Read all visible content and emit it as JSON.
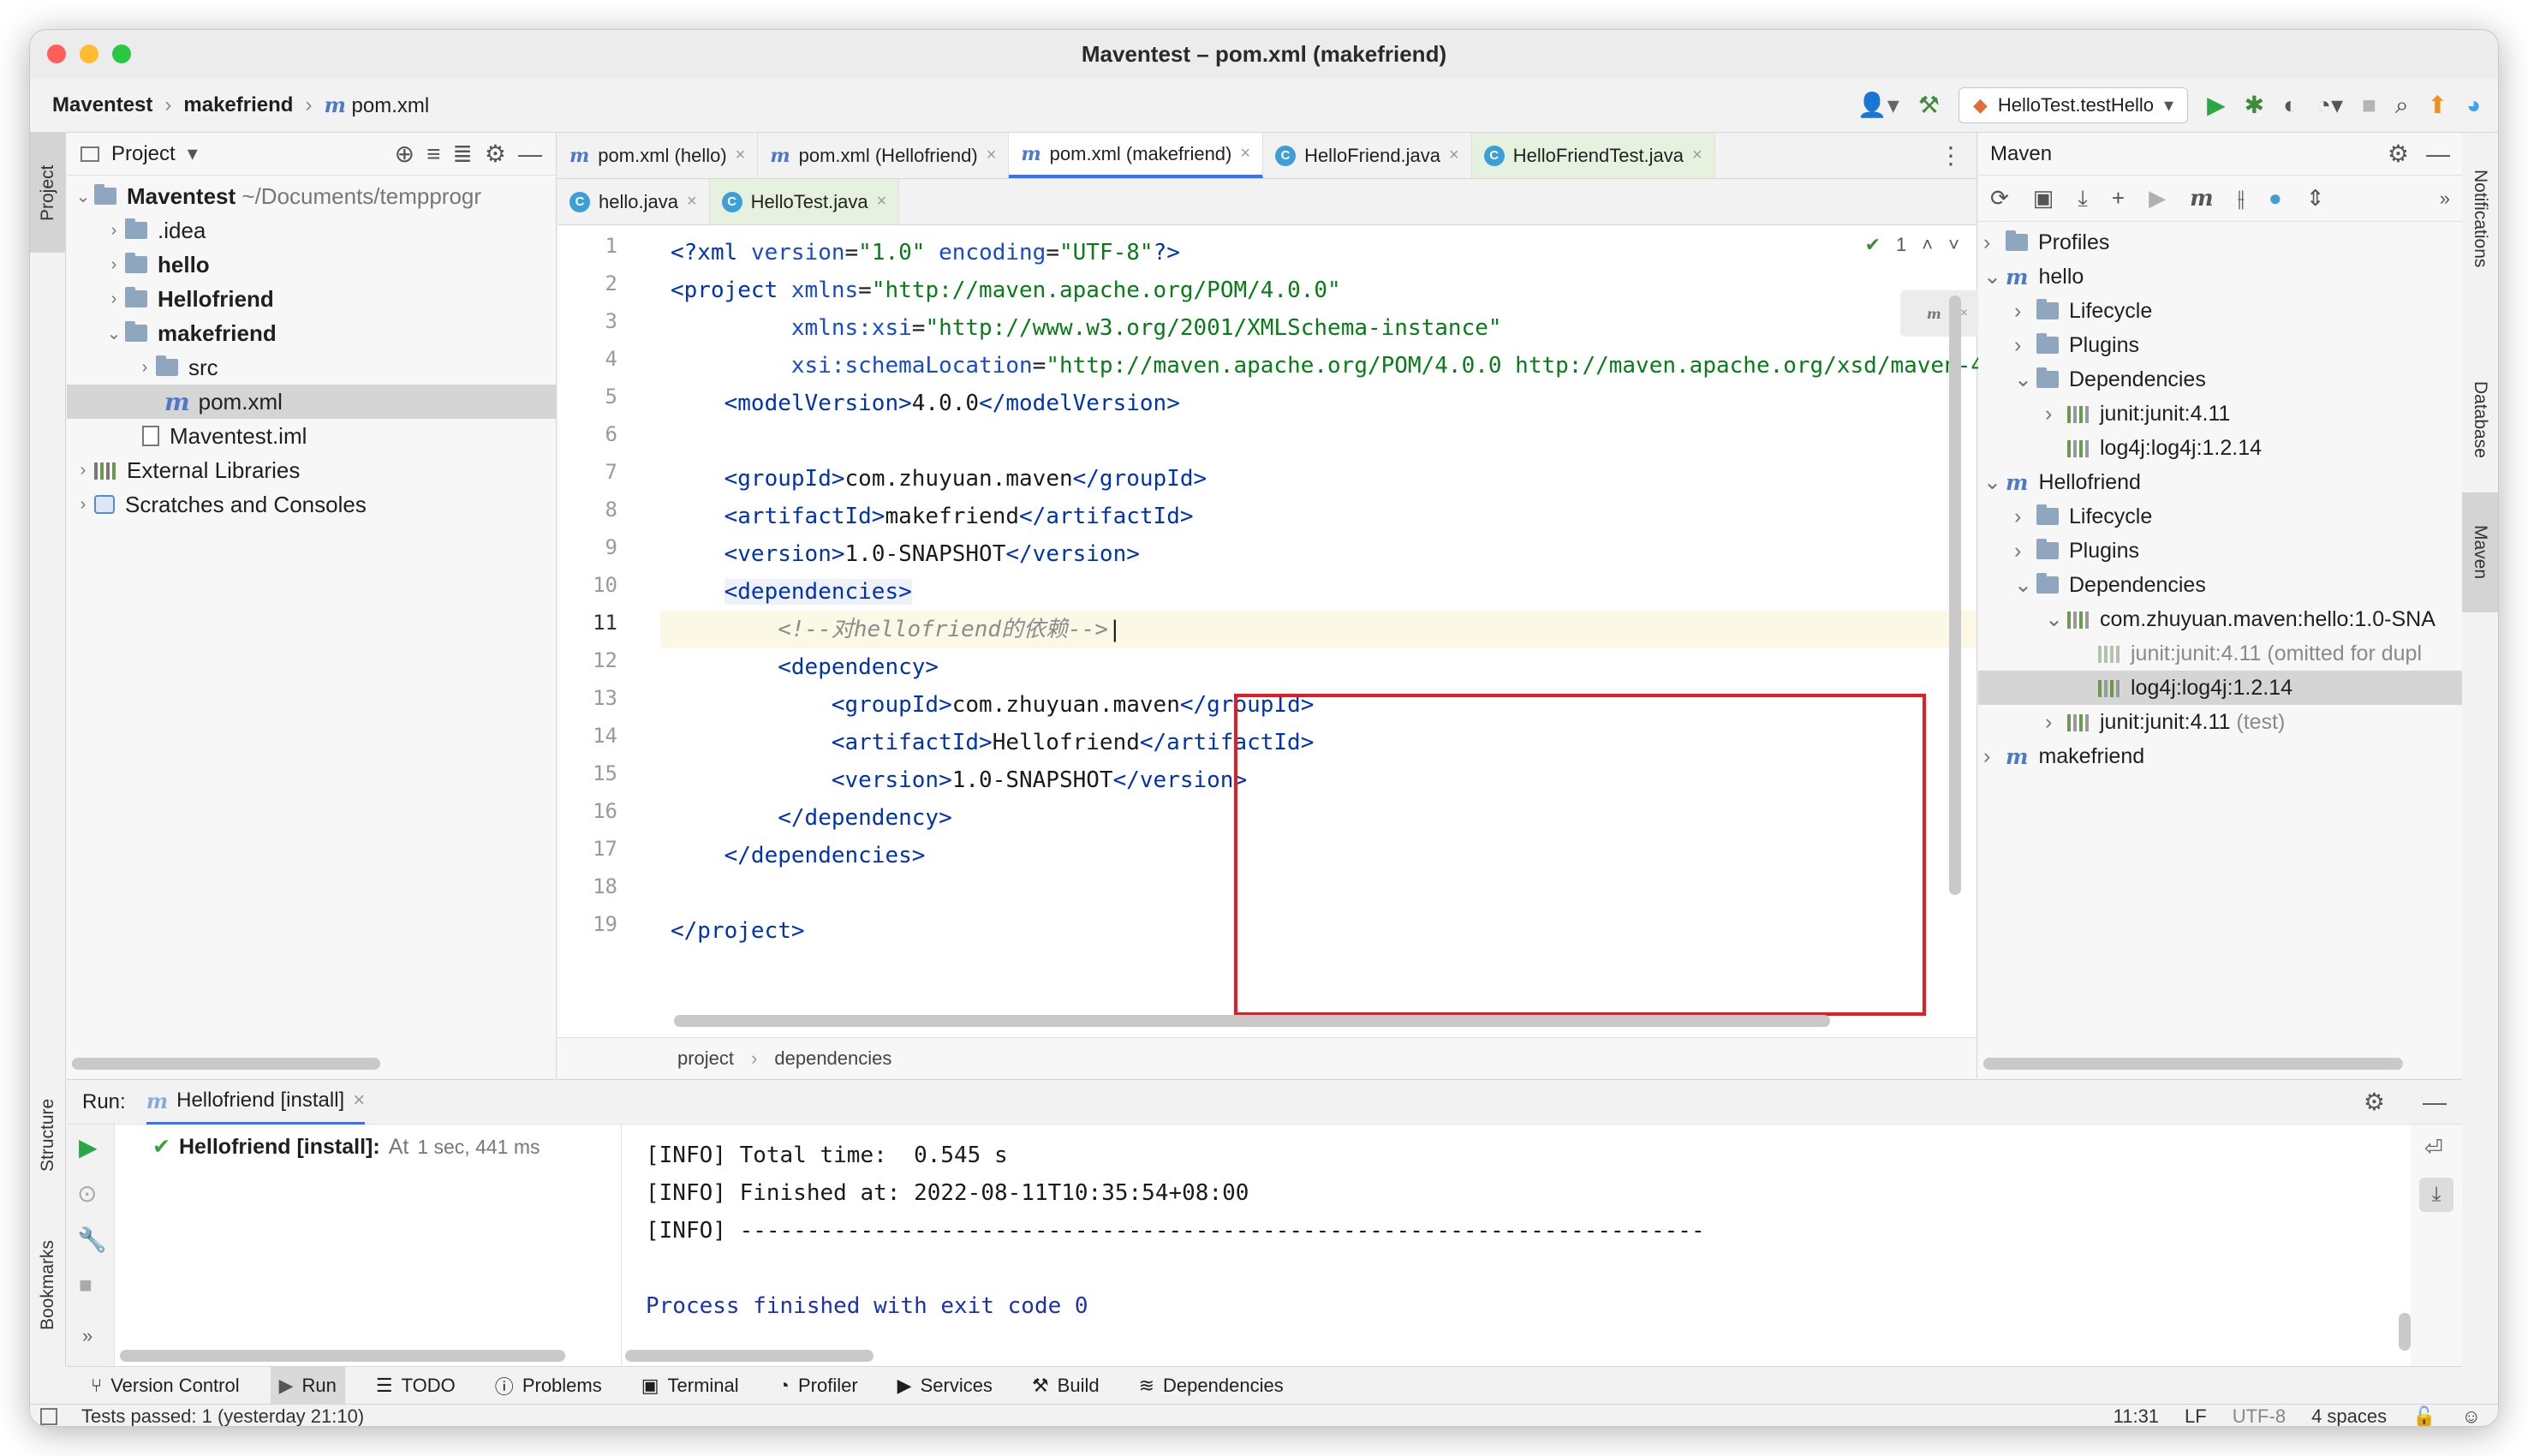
{
  "window": {
    "title": "Maventest – pom.xml (makefriend)"
  },
  "nav": {
    "crumbs": [
      "Maventest",
      "makefriend",
      "pom.xml"
    ],
    "run_config": "HelloTest.testHello"
  },
  "colors": {
    "accent": "#3574f0",
    "tag": "#0033b3",
    "string": "#067d17",
    "comment": "#8c8c8c",
    "red_box": "#e51c23",
    "run_green": "#28a745"
  },
  "side_left": {
    "project": "Project",
    "structure": "Structure",
    "bookmarks": "Bookmarks"
  },
  "side_right": {
    "notifications": "Notifications",
    "database": "Database",
    "maven": "Maven"
  },
  "project_panel": {
    "title": "Project",
    "tree": [
      {
        "label": "Maventest",
        "suffix": "~/Documents/tempprogr",
        "bold": true
      },
      {
        "label": ".idea"
      },
      {
        "label": "hello",
        "bold": true
      },
      {
        "label": "Hellofriend",
        "bold": true
      },
      {
        "label": "makefriend",
        "bold": true
      },
      {
        "label": "src"
      },
      {
        "label": "pom.xml"
      },
      {
        "label": "Maventest.iml"
      },
      {
        "label": "External Libraries"
      },
      {
        "label": "Scratches and Consoles"
      }
    ]
  },
  "editor": {
    "tabs_row1": [
      "pom.xml (hello)",
      "pom.xml (Hellofriend)",
      "pom.xml (makefriend)",
      "HelloFriend.java",
      "HelloFriendTest.java"
    ],
    "tabs_row2": [
      "hello.java",
      "HelloTest.java"
    ],
    "inspection_count": "1",
    "line_numbers": [
      "1",
      "2",
      "3",
      "4",
      "5",
      "6",
      "7",
      "8",
      "9",
      "10",
      "11",
      "12",
      "13",
      "14",
      "15",
      "16",
      "17",
      "18",
      "19"
    ],
    "breadcrumb": [
      "project",
      "dependencies"
    ]
  },
  "maven": {
    "title": "Maven",
    "tree": [
      {
        "label": "Profiles"
      },
      {
        "label": "hello"
      },
      {
        "label": "Lifecycle"
      },
      {
        "label": "Plugins"
      },
      {
        "label": "Dependencies"
      },
      {
        "label": "junit:junit:4.11"
      },
      {
        "label": "log4j:log4j:1.2.14"
      },
      {
        "label": "Hellofriend"
      },
      {
        "label": "Lifecycle"
      },
      {
        "label": "Plugins"
      },
      {
        "label": "Dependencies"
      },
      {
        "label": "com.zhuyuan.maven:hello:1.0-SNA"
      },
      {
        "label": "junit:junit:4.11 (omitted for dupl"
      },
      {
        "label": "log4j:log4j:1.2.14"
      },
      {
        "label": "junit:junit:4.11",
        "note": "(test)"
      },
      {
        "label": "makefriend"
      }
    ]
  },
  "run": {
    "label": "Run:",
    "tab": "Hellofriend [install]",
    "tree_item": "Hellofriend [install]:",
    "tree_item_suffix": "At",
    "tree_item_time": "1 sec, 441 ms",
    "console": [
      "[INFO] Total time:  0.545 s",
      "[INFO] Finished at: 2022-08-11T10:35:54+08:00",
      "[INFO] ------------------------------------------------------------------------",
      "",
      "Process finished with exit code 0"
    ]
  },
  "bottom_tabs": [
    "Version Control",
    "Run",
    "TODO",
    "Problems",
    "Terminal",
    "Profiler",
    "Services",
    "Build",
    "Dependencies"
  ],
  "status": {
    "message": "Tests passed: 1 (yesterday 21:10)",
    "position": "11:31",
    "line_sep": "LF",
    "encoding": "UTF-8",
    "indent": "4 spaces"
  }
}
